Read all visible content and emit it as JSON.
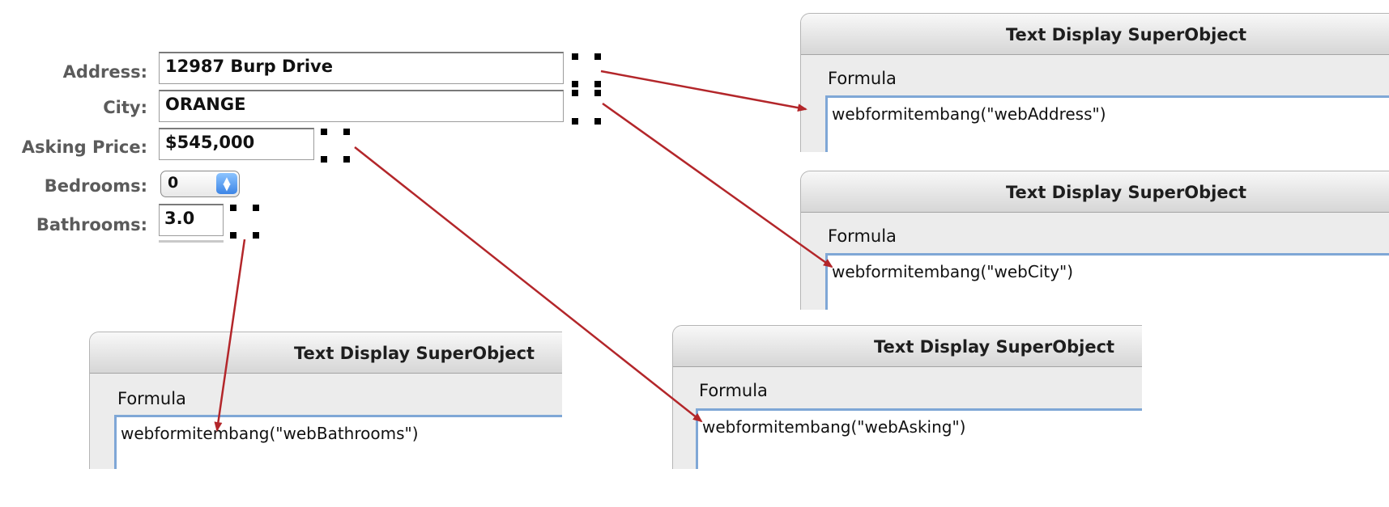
{
  "form": {
    "address": {
      "label": "Address:",
      "value": "12987 Burp Drive"
    },
    "city": {
      "label": "City:",
      "value": "ORANGE"
    },
    "asking_price": {
      "label": "Asking Price:",
      "value": "$545,000"
    },
    "bedrooms": {
      "label": "Bedrooms:",
      "value": "0"
    },
    "bathrooms": {
      "label": "Bathrooms:",
      "value": "3.0"
    }
  },
  "dialogs": [
    {
      "title": "Text Display SuperObject",
      "section": "Formula",
      "formula": "webformitembang(\"webAddress\")"
    },
    {
      "title": "Text Display SuperObject",
      "section": "Formula",
      "formula": "webformitembang(\"webCity\")"
    },
    {
      "title": "Text Display SuperObject",
      "section": "Formula",
      "formula": "webformitembang(\"webBathrooms\")"
    },
    {
      "title": "Text Display SuperObject",
      "section": "Formula",
      "formula": "webformitembang(\"webAsking\")"
    }
  ],
  "colors": {
    "arrow": "#b3262a",
    "focus_ring": "#7fa7d6"
  },
  "icons": {
    "popup_arrow": "up-down-chevron-icon"
  }
}
